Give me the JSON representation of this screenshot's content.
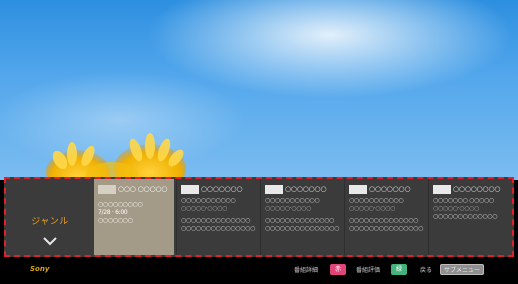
{
  "colors": {
    "sky": "#4a9fe8",
    "strip": "#3b3b3b",
    "selected": "#a49a88",
    "highlight_border": "#e0202a",
    "nav_label": "#f0a020",
    "key_red": "#e0457a",
    "key_green": "#44b27a",
    "logo": "#d7a21c"
  },
  "nav": {
    "label": "ジャンル",
    "chevron_icon": "chevron-down-icon"
  },
  "cards": [
    {
      "title": "○○○ ○○○○○",
      "lines": [
        "○○○○○○○○○",
        "7/28 · 6:00",
        "○○○○○○○"
      ]
    },
    {
      "title": "○○○○○○○",
      "lines": [
        "○○○○○○○○○○○",
        "○○○○○·○○○○",
        "○○○○○○○○○○○○○○",
        "○○○○○○○○○○○○○○○"
      ]
    },
    {
      "title": "○○○○○○○",
      "lines": [
        "○○○○○○○○○○○",
        "○○○○○·○○○○",
        "○○○○○○○○○○○○○○",
        "○○○○○○○○○○○○○○○"
      ]
    },
    {
      "title": "○○○○○○○",
      "lines": [
        "○○○○○○○○○○○",
        "○○○○○·○○○○",
        "○○○○○○○○○○○○○○",
        "○○○○○○○○○○○○○○○"
      ]
    },
    {
      "title": "○○○○○○○○",
      "lines": [
        "○○○○○○○ ○○○○○",
        "○○○○○·○○○○",
        "○○○○○○○○○○○○○"
      ]
    }
  ],
  "bottom": {
    "logo": "Sony",
    "key1_label": "番組詳細",
    "key1": "赤",
    "key2_label": "番組評価",
    "key2": "緑",
    "key3_label": "戻る",
    "key3": "サブメニュー"
  }
}
